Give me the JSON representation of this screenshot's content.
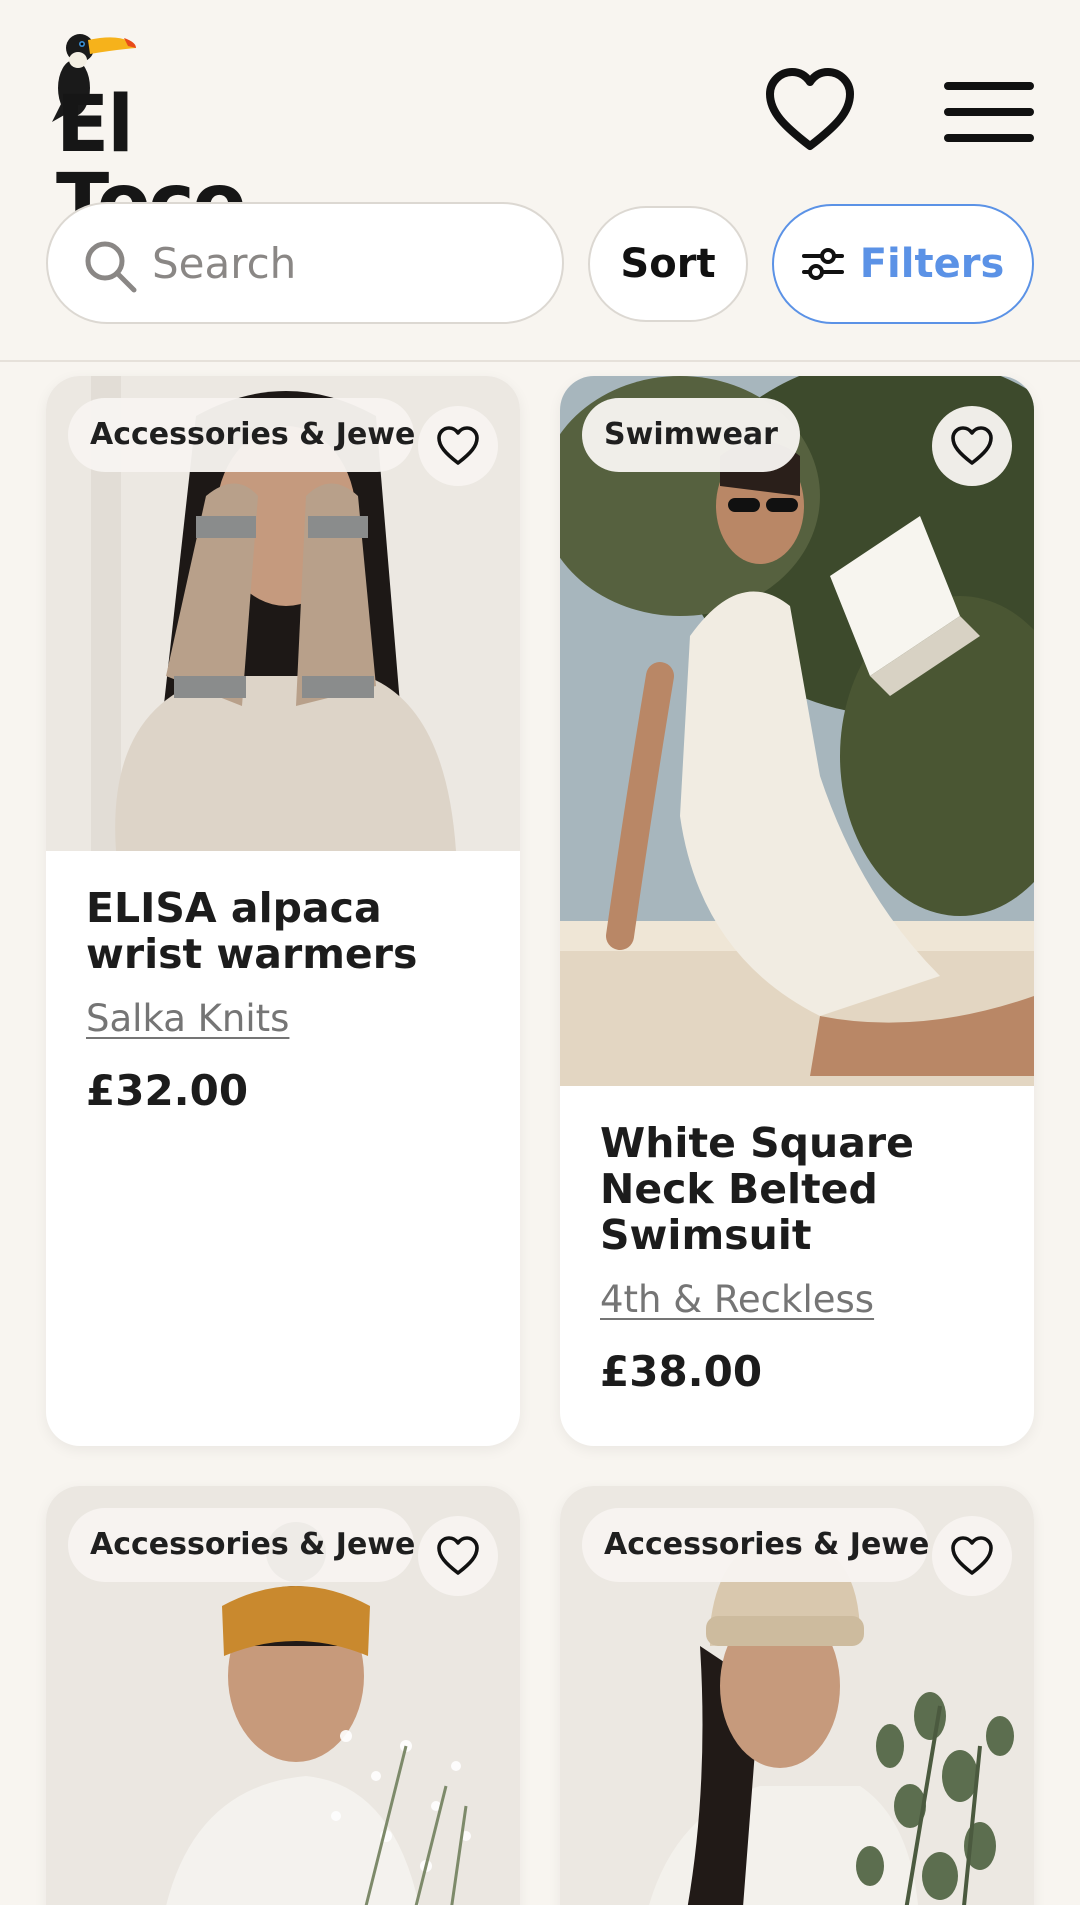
{
  "header": {
    "logo_text": "El Toco",
    "icons": {
      "logo": "toucan-logo",
      "favorites": "heart-icon",
      "menu": "hamburger-menu-icon"
    }
  },
  "toolbar": {
    "search_placeholder": "Search",
    "search_icon": "search-icon",
    "sort_label": "Sort",
    "filters_label": "Filters",
    "filters_icon": "sliders-icon",
    "accent_color": "#5b92e6"
  },
  "products": [
    {
      "badge": "Accessories & Jewellery",
      "title": "ELISA alpaca wrist warmers",
      "brand": "Salka Knits",
      "price": "£32.00"
    },
    {
      "badge": "Swimwear",
      "title": "White Square Neck Belted Swimsuit",
      "brand": "4th & Reckless",
      "price": "£38.00"
    },
    {
      "badge": "Accessories & Jewellery",
      "title": "",
      "brand": "",
      "price": ""
    },
    {
      "badge": "Accessories & Jewellery",
      "title": "",
      "brand": "",
      "price": ""
    }
  ]
}
